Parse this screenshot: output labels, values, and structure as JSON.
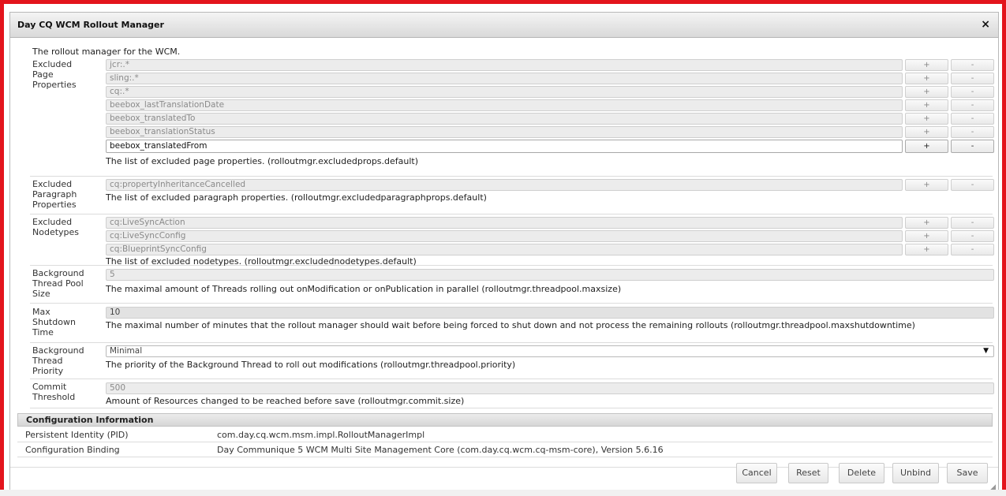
{
  "dialog": {
    "title": "Day CQ WCM Rollout Manager",
    "close_icon": "×",
    "description": "The rollout manager for the WCM."
  },
  "fields": {
    "excluded_page_properties": {
      "label": "Excluded Page Properties",
      "values": [
        "jcr:.*",
        "sling:.*",
        "cq:.*",
        "beebox_lastTranslationDate",
        "beebox_translatedTo",
        "beebox_translationStatus",
        "beebox_translatedFrom"
      ],
      "help": "The list of excluded page properties. (rolloutmgr.excludedprops.default)"
    },
    "excluded_paragraph_properties": {
      "label": "Excluded Paragraph Properties",
      "values": [
        "cq:propertyInheritanceCancelled"
      ],
      "help": "The list of excluded paragraph properties. (rolloutmgr.excludedparagraphprops.default)"
    },
    "excluded_nodetypes": {
      "label": "Excluded Nodetypes",
      "values": [
        "cq:LiveSyncAction",
        "cq:LiveSyncConfig",
        "cq:BlueprintSyncConfig"
      ],
      "help": "The list of excluded nodetypes. (rolloutmgr.excludednodetypes.default)"
    },
    "background_thread_pool_size": {
      "label": "Background Thread Pool Size",
      "value": "5",
      "help": "The maximal amount of Threads rolling out onModification or onPublication in parallel (rolloutmgr.threadpool.maxsize)"
    },
    "max_shutdown_time": {
      "label": "Max Shutdown Time",
      "value": "10",
      "help": "The maximal number of minutes that the rollout manager should wait before being forced to shut down and not process the remaining rollouts (rolloutmgr.threadpool.maxshutdowntime)"
    },
    "background_thread_priority": {
      "label": "Background Thread Priority",
      "value": "Minimal",
      "help": "The priority of the Background Thread to roll out modifications (rolloutmgr.threadpool.priority)"
    },
    "commit_threshold": {
      "label": "Commit Threshold",
      "value": "500",
      "help": "Amount of Resources changed to be reached before save (rolloutmgr.commit.size)"
    }
  },
  "buttons": {
    "plus": "+",
    "minus": "-"
  },
  "config_info": {
    "heading": "Configuration Information",
    "pid_label": "Persistent Identity (PID)",
    "pid_value": "com.day.cq.wcm.msm.impl.RolloutManagerImpl",
    "binding_label": "Configuration Binding",
    "binding_value": "Day Communique 5 WCM Multi Site Management Core (com.day.cq.wcm.cq-msm-core), Version 5.6.16"
  },
  "footer": {
    "cancel": "Cancel",
    "reset": "Reset",
    "delete": "Delete",
    "unbind": "Unbind",
    "save": "Save"
  },
  "icons": {
    "close": "close-icon",
    "dropdown": "chevron-down-icon",
    "resize": "resize-grip-icon"
  },
  "colors": {
    "frame": "#e3141c"
  }
}
